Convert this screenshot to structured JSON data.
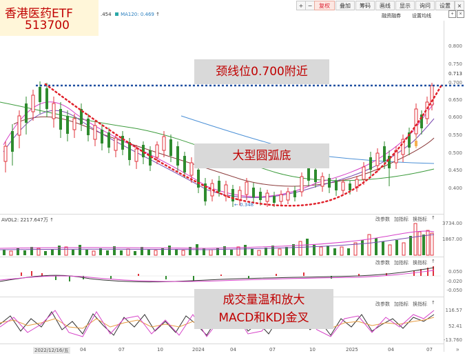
{
  "title": {
    "name": "香港医药ETF",
    "code": "513700"
  },
  "toolbar": {
    "nav_first": "+",
    "nav_prev": "−",
    "nav_next": "←",
    "nav_last": "→",
    "buttons": [
      "复权",
      "叠加",
      "筹码",
      "画线",
      "显示",
      "询问",
      "设置"
    ],
    "row2": [
      "融资融券",
      "设置均线"
    ]
  },
  "ma_readout": {
    "ma60": ".454",
    "ma120": "MA120: 0.469",
    "arrow": "↑"
  },
  "price_axis": [
    "0.800",
    "0.750",
    "0.713",
    "0.700",
    "0.650",
    "0.600",
    "0.550",
    "0.500",
    "0.450",
    "0.400"
  ],
  "low_marker": "← 0.348",
  "volume_panel": {
    "label": "AVOL2: 2217.647万 ↑",
    "controls": [
      "改参数",
      "加指标",
      "换指标"
    ],
    "axis": [
      "3734.00",
      "1867.00"
    ]
  },
  "macd_panel": {
    "controls": [
      "改参数",
      "加指标",
      "换指标"
    ],
    "axis": [
      "0.050",
      "-0.020",
      "-0.050"
    ]
  },
  "kdj_panel": {
    "controls": [
      "改参数",
      "加指标",
      "换指标"
    ],
    "axis": [
      "116.57",
      "52.41",
      "-13.760"
    ]
  },
  "x_axis": [
    "2022/12/16/五",
    "04",
    "07",
    "10",
    "2024",
    "04",
    "07",
    "10",
    "2025",
    "04",
    "07"
  ],
  "annotations": {
    "neckline": "颈线位0.700附近",
    "pattern": "大型圆弧底",
    "signal_line1": "成交量温和放大",
    "signal_line2": "MACD和KDJ金叉"
  },
  "colors": {
    "up": "#e0303a",
    "down": "#2e8b2e",
    "accent": "#c00000",
    "neckline": "#1f4fa0"
  }
}
